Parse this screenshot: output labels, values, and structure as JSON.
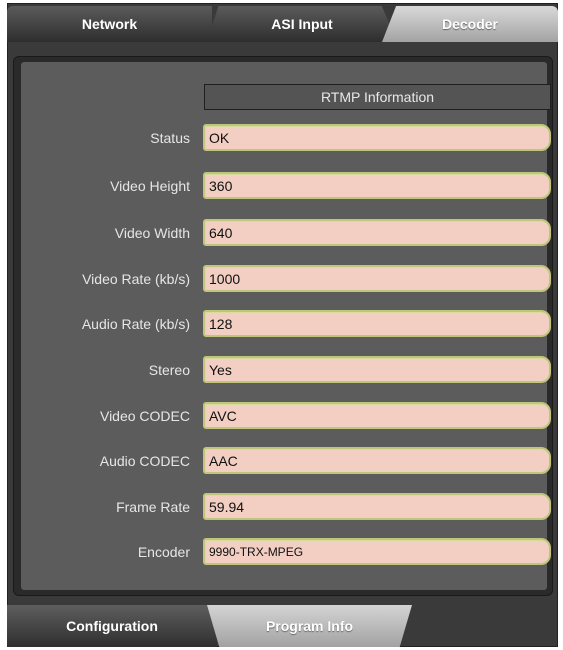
{
  "top_tabs": [
    {
      "label": "Network",
      "active": false
    },
    {
      "label": "ASI Input",
      "active": false
    },
    {
      "label": "Decoder",
      "active": true
    }
  ],
  "section": {
    "title": "RTMP Information"
  },
  "fields": [
    {
      "label": "Status",
      "value": "OK"
    },
    {
      "label": "Video Height",
      "value": "360"
    },
    {
      "label": "Video Width",
      "value": "640"
    },
    {
      "label": "Video Rate (kb/s)",
      "value": "1000"
    },
    {
      "label": "Audio Rate (kb/s)",
      "value": "128"
    },
    {
      "label": "Stereo",
      "value": "Yes"
    },
    {
      "label": "Video CODEC",
      "value": "AVC"
    },
    {
      "label": "Audio CODEC",
      "value": "AAC"
    },
    {
      "label": "Frame Rate",
      "value": "59.94"
    },
    {
      "label": "Encoder",
      "value": "9990-TRX-MPEG"
    }
  ],
  "bottom_tabs": [
    {
      "label": "Configuration",
      "active": false
    },
    {
      "label": "Program Info",
      "active": true
    }
  ],
  "colors": {
    "field_bg": "#f2cfc2",
    "field_border": "#bfc67a",
    "panel_bg": "#5c5c5c",
    "frame_bg": "#3a3a3a"
  }
}
